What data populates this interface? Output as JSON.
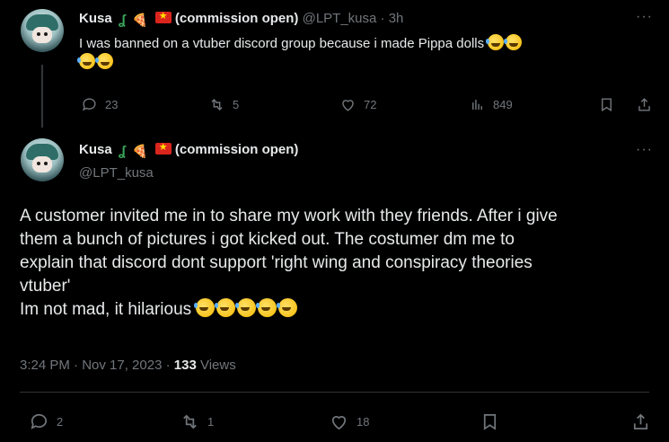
{
  "reply": {
    "author_name": "Kusa",
    "author_suffix": "(commission open)",
    "handle": "@LPT_kusa",
    "time": "· 3h",
    "text": "I was banned on a vtuber discord group because i made Pippa dolls",
    "text_emoji_count_line1": 2,
    "text_emoji_count_line2": 2,
    "stats": {
      "replies": "23",
      "reposts": "5",
      "likes": "72",
      "views": "849"
    }
  },
  "main": {
    "author_name": "Kusa",
    "author_suffix": "(commission open)",
    "handle": "@LPT_kusa",
    "lines": [
      "A customer invited me in to share my work with they friends. After i give",
      "them a bunch of pictures i got kicked out. The costumer dm me to",
      "explain that discord dont support 'right wing and conspiracy theories",
      "vtuber'",
      "Im not mad, it hilarious"
    ],
    "last_line_emoji_count": 5,
    "timestamp": "3:24 PM · Nov 17, 2023 · ",
    "views_count": "133",
    "views_label": " Views",
    "stats": {
      "replies": "2",
      "reposts": "1",
      "likes": "18"
    }
  },
  "icons": {
    "reply": "speech-bubble-icon",
    "repost": "repost-arrows-icon",
    "like": "heart-icon",
    "views": "bar-chart-icon",
    "bookmark": "bookmark-icon",
    "share": "share-upload-icon",
    "more": "more-dots-icon"
  }
}
